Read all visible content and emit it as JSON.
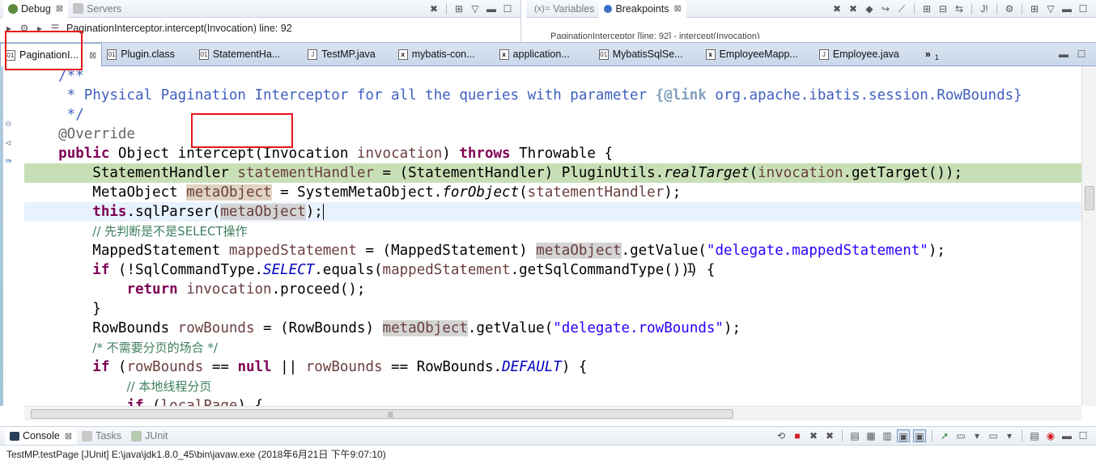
{
  "debug_panel": {
    "tabs": [
      {
        "label": "Debug",
        "close": "⊠",
        "active": true
      },
      {
        "label": "Servers",
        "active": false
      }
    ],
    "breadcrumb": "PaginationInterceptor.intercept(Invocation) line: 92"
  },
  "vars_panel": {
    "tabs": [
      {
        "label": "Variables",
        "prefix": "(x)=",
        "active": false
      },
      {
        "label": "Breakpoints",
        "close": "⊠",
        "active": true
      }
    ],
    "row_text": "PaginationInterceptor [line: 92] - intercept(Invocation)"
  },
  "editor_tabs": [
    {
      "label": "PaginationI...",
      "close": "⊠",
      "active": true,
      "icon": "class-file-icon"
    },
    {
      "label": "Plugin.class",
      "active": false,
      "icon": "class-file-icon"
    },
    {
      "label": "StatementHa...",
      "active": false,
      "icon": "class-file-icon"
    },
    {
      "label": "TestMP.java",
      "active": false,
      "icon": "java-file-icon"
    },
    {
      "label": "mybatis-con...",
      "active": false,
      "icon": "xml-file-icon"
    },
    {
      "label": "application...",
      "active": false,
      "icon": "xml-file-icon"
    },
    {
      "label": "MybatisSqlSe...",
      "active": false,
      "icon": "class-file-icon"
    },
    {
      "label": "EmployeeMapp...",
      "active": false,
      "icon": "xml-file-icon"
    },
    {
      "label": "Employee.java",
      "active": false,
      "icon": "java-file-icon"
    }
  ],
  "editor_overflow": "»",
  "editor_overflow_count": "1",
  "code": {
    "l1": "    /**",
    "l2a": "     * Physical Pagination Interceptor for all the queries with parameter ",
    "l2b": "{@link",
    "l2c": " org.apache.ibatis.session.RowBounds}",
    "l3": "     */",
    "l4": "    @Override",
    "l5_public": "public",
    "l5_a": " Object intercept(Invocation ",
    "l5_inv": "invocation",
    "l5_b": ") ",
    "l5_throws": "throws",
    "l5_c": " Throwable {",
    "l6_a": "StatementHandler ",
    "l6_var": "statementHandler",
    "l6_b": " = (StatementHandler) PluginUtils.",
    "l6_m": "realTarget",
    "l6_c": "(",
    "l6_inv": "invocation",
    "l6_d": ".getTarget());",
    "l7_a": "MetaObject ",
    "l7_var": "metaObject",
    "l7_b": " = SystemMetaObject.",
    "l7_m": "forObject",
    "l7_c": "(",
    "l7_sh": "statementHandler",
    "l7_d": ");",
    "l8_this": "this",
    "l8_a": ".sqlParser(",
    "l8_mo": "metaObject",
    "l8_b": ");",
    "l9": "// 先判断是不是SELECT操作",
    "l10_a": "MappedStatement ",
    "l10_var": "mappedStatement",
    "l10_b": " = (MappedStatement) ",
    "l10_mo": "metaObject",
    "l10_c": ".getValue(",
    "l10_str": "\"delegate.mappedStatement\"",
    "l10_d": ");",
    "l11_if": "if",
    "l11_a": " (!SqlCommandType.",
    "l11_sel": "SELECT",
    "l11_b": ".equals(",
    "l11_ms": "mappedStatement",
    "l11_c": ".getSqlCommandType())) {",
    "l12_ret": "return",
    "l12_a": " ",
    "l12_inv": "invocation",
    "l12_b": ".proceed();",
    "l13": "}",
    "l14_a": "RowBounds ",
    "l14_var": "rowBounds",
    "l14_b": " = (RowBounds) ",
    "l14_mo": "metaObject",
    "l14_c": ".getValue(",
    "l14_str": "\"delegate.rowBounds\"",
    "l14_d": ");",
    "l15": "/* 不需要分页的场合 */",
    "l16_if": "if",
    "l16_a": " (",
    "l16_rb": "rowBounds",
    "l16_b": " == ",
    "l16_null": "null",
    "l16_c": " || ",
    "l16_rb2": "rowBounds",
    "l16_d": " == RowBounds.",
    "l16_def": "DEFAULT",
    "l16_e": ") {",
    "l17": "// 本地线程分页",
    "l18_if": "if",
    "l18_a": " (",
    "l18_lp": "localPage",
    "l18_b": ") {"
  },
  "console": {
    "tabs": [
      {
        "label": "Console",
        "close": "⊠",
        "active": true
      },
      {
        "label": "Tasks",
        "active": false
      },
      {
        "label": "JUnit",
        "active": false
      }
    ],
    "status": "TestMP.testPage [JUnit] E:\\java\\jdk1.8.0_45\\bin\\javaw.exe (2018年6月21日 下午9:07:10)"
  },
  "colors": {
    "annotation_box": "#e8151b",
    "debug_line_highlight": "#c8dfb6",
    "current_line_highlight": "#e8f2fe",
    "keyword": "#7f0055",
    "javadoc": "#3f5fbf",
    "string": "#2a00ff",
    "comment": "#3f7f5f"
  }
}
